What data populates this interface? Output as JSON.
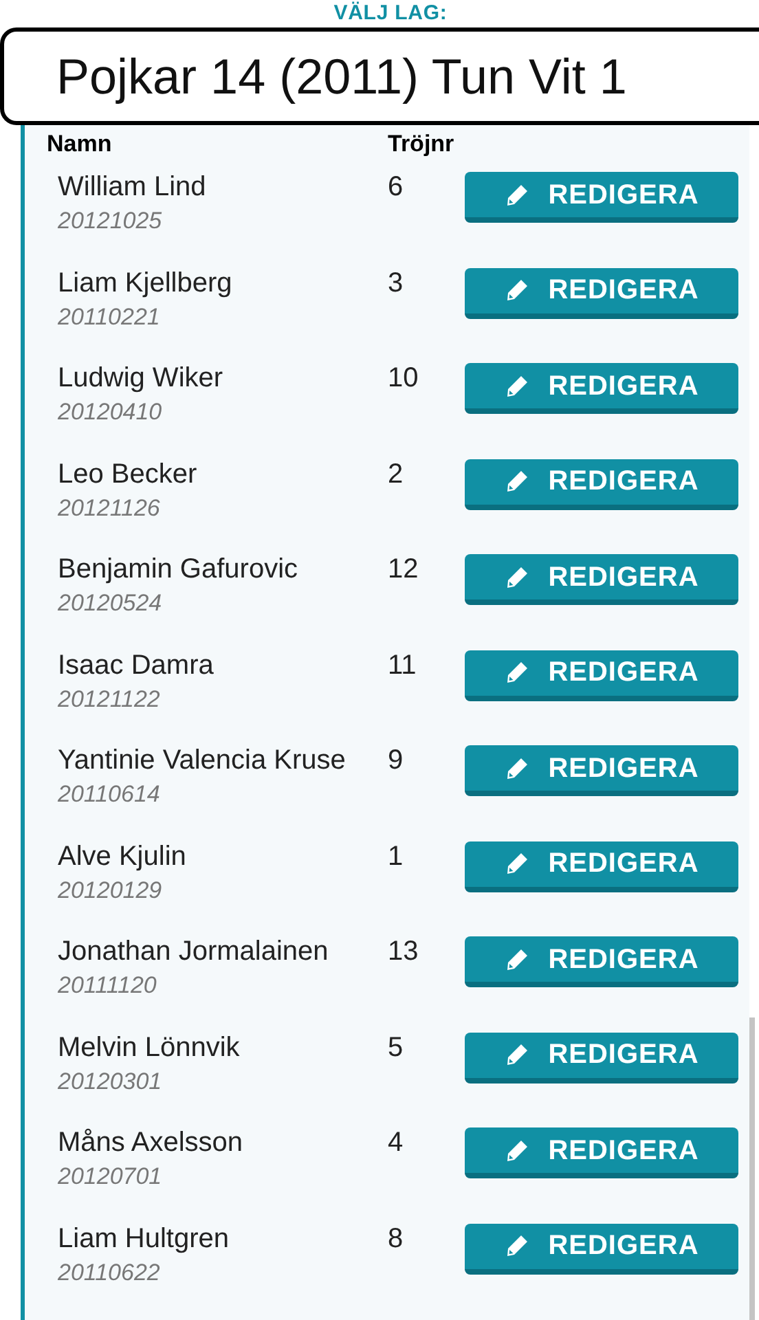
{
  "heading": "VÄLJ LAG:",
  "team_select": {
    "value": "Pojkar 14 (2011) Tun Vit 1"
  },
  "table": {
    "columns": [
      "Namn",
      "Tröjnr"
    ],
    "rows": [
      {
        "name": "William Lind",
        "date": "20121025",
        "number": "6",
        "button": "REDIGERA"
      },
      {
        "name": "Liam Kjellberg",
        "date": "20110221",
        "number": "3",
        "button": "REDIGERA"
      },
      {
        "name": "Ludwig Wiker",
        "date": "20120410",
        "number": "10",
        "button": "REDIGERA"
      },
      {
        "name": "Leo Becker",
        "date": "20121126",
        "number": "2",
        "button": "REDIGERA"
      },
      {
        "name": "Benjamin Gafurovic",
        "date": "20120524",
        "number": "12",
        "button": "REDIGERA"
      },
      {
        "name": "Isaac Damra",
        "date": "20121122",
        "number": "11",
        "button": "REDIGERA"
      },
      {
        "name": "Yantinie Valencia Kruse",
        "date": "20110614",
        "number": "9",
        "button": "REDIGERA"
      },
      {
        "name": "Alve Kjulin",
        "date": "20120129",
        "number": "1",
        "button": "REDIGERA"
      },
      {
        "name": "Jonathan Jormalainen",
        "date": "20111120",
        "number": "13",
        "button": "REDIGERA"
      },
      {
        "name": "Melvin Lönnvik",
        "date": "20120301",
        "number": "5",
        "button": "REDIGERA"
      },
      {
        "name": "Måns Axelsson",
        "date": "20120701",
        "number": "4",
        "button": "REDIGERA"
      },
      {
        "name": "Liam Hultgren",
        "date": "20110622",
        "number": "8",
        "button": "REDIGERA"
      }
    ]
  }
}
